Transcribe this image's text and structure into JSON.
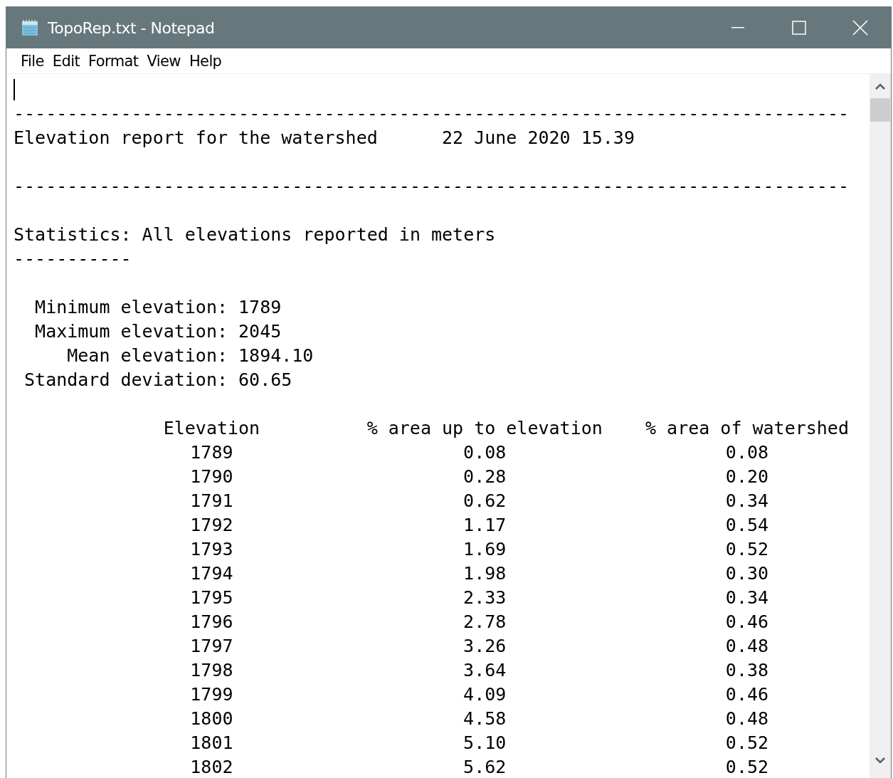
{
  "window": {
    "title": "TopoRep.txt - Notepad"
  },
  "menu": [
    {
      "label": "File"
    },
    {
      "label": "Edit"
    },
    {
      "label": "Format"
    },
    {
      "label": "View"
    },
    {
      "label": "Help"
    }
  ],
  "report": {
    "rule_top": "------------------------------------------------------------------------------",
    "title": "Elevation report for the watershed",
    "timestamp": "22 June 2020 15.39",
    "rule_mid": "------------------------------------------------------------------------------",
    "section_title": "Statistics: All elevations reported in meters",
    "section_underline": "-----------",
    "stats": [
      {
        "label": "Minimum elevation:",
        "value": "1789"
      },
      {
        "label": "Maximum elevation:",
        "value": "2045"
      },
      {
        "label": "Mean elevation:",
        "value": "1894.10"
      },
      {
        "label": "Standard deviation:",
        "value": "60.65"
      }
    ],
    "table": {
      "columns": [
        "Elevation",
        "% area up to elevation",
        "% area of watershed"
      ],
      "rows": [
        [
          "1789",
          "0.08",
          "0.08"
        ],
        [
          "1790",
          "0.28",
          "0.20"
        ],
        [
          "1791",
          "0.62",
          "0.34"
        ],
        [
          "1792",
          "1.17",
          "0.54"
        ],
        [
          "1793",
          "1.69",
          "0.52"
        ],
        [
          "1794",
          "1.98",
          "0.30"
        ],
        [
          "1795",
          "2.33",
          "0.34"
        ],
        [
          "1796",
          "2.78",
          "0.46"
        ],
        [
          "1797",
          "3.26",
          "0.48"
        ],
        [
          "1798",
          "3.64",
          "0.38"
        ],
        [
          "1799",
          "4.09",
          "0.46"
        ],
        [
          "1800",
          "4.58",
          "0.48"
        ],
        [
          "1801",
          "5.10",
          "0.52"
        ],
        [
          "1802",
          "5.62",
          "0.52"
        ]
      ]
    }
  }
}
